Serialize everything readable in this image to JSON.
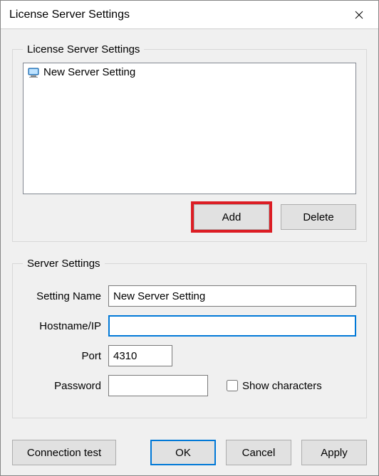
{
  "window": {
    "title": "License Server Settings"
  },
  "group_servers": {
    "legend": "License Server Settings",
    "items": [
      {
        "label": "New Server Setting"
      }
    ],
    "add_label": "Add",
    "delete_label": "Delete"
  },
  "group_settings": {
    "legend": "Server Settings",
    "setting_name_label": "Setting Name",
    "setting_name_value": "New Server Setting",
    "hostname_label": "Hostname/IP",
    "hostname_value": "",
    "port_label": "Port",
    "port_value": "4310",
    "password_label": "Password",
    "password_value": "",
    "show_chars_label": "Show characters"
  },
  "buttons": {
    "connection_test": "Connection test",
    "ok": "OK",
    "cancel": "Cancel",
    "apply": "Apply"
  }
}
